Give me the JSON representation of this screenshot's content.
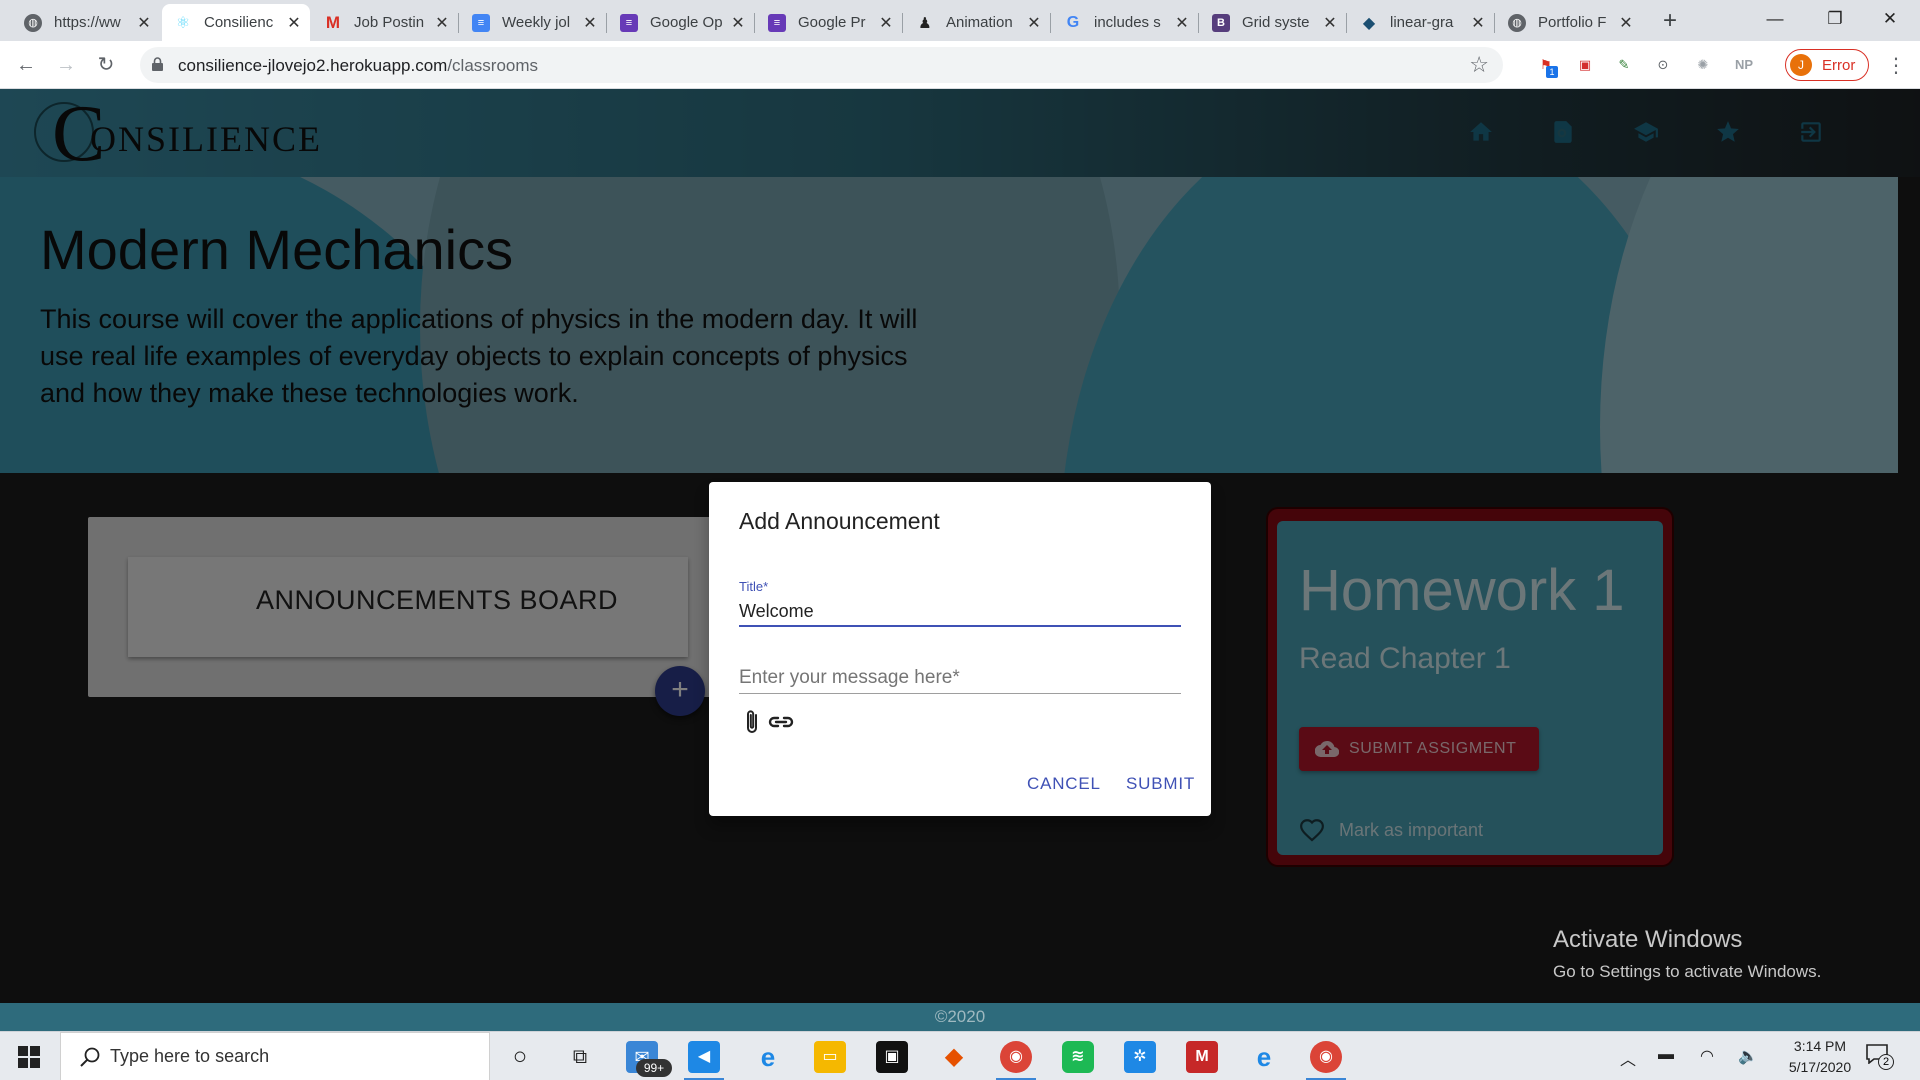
{
  "browser": {
    "tabs": [
      {
        "title": "https://ww",
        "icon": "globe-icon",
        "color": "#5f6368"
      },
      {
        "title": "Consilienc",
        "icon": "react-icon",
        "color": "#61dafb"
      },
      {
        "title": "Job Postin",
        "icon": "gmail-icon",
        "color": "#d93025"
      },
      {
        "title": "Weekly jol",
        "icon": "docs-icon",
        "color": "#4285f4"
      },
      {
        "title": "Google Op",
        "icon": "forms-icon",
        "color": "#673ab7"
      },
      {
        "title": "Google Pr",
        "icon": "forms-icon",
        "color": "#673ab7"
      },
      {
        "title": "Animation",
        "icon": "penguin-icon",
        "color": "#222222"
      },
      {
        "title": "includes s",
        "icon": "google-icon",
        "color": "#4285f4"
      },
      {
        "title": "Grid syste",
        "icon": "bootstrap-icon",
        "color": "#563d7c"
      },
      {
        "title": "linear-gra",
        "icon": "bird-icon",
        "color": "#1b4f72"
      },
      {
        "title": "Portfolio F",
        "icon": "globe-icon",
        "color": "#5f6368"
      }
    ],
    "active_tab_index": 1,
    "url_host": "consilience-jlovejo2.herokuapp.com",
    "url_path": "/classrooms",
    "profile": {
      "initial": "J",
      "label": "Error"
    },
    "ext_np": "NP",
    "ext_badge": "1"
  },
  "app": {
    "logo_letter": "C",
    "logo_text": "ONSILIENCE",
    "nav_icons": [
      "home-icon",
      "search-doc-icon",
      "school-icon",
      "star-icon",
      "exit-icon"
    ],
    "course": {
      "title": "Modern Mechanics",
      "description": "This course will cover the applications of physics in the modern day. It will use real life examples of everyday objects to explain concepts of physics and how they make these technologies work."
    },
    "announcements": {
      "title": "ANNOUNCEMENTS BOARD",
      "add_label": "+"
    },
    "homework": {
      "title": "Homework 1",
      "subtitle": "Read Chapter 1",
      "submit_label": "SUBMIT ASSIGMENT",
      "important_label": "Mark as important"
    },
    "footer": "©2020"
  },
  "dialog": {
    "title": "Add Announcement",
    "title_label": "Title*",
    "title_value": "Welcome",
    "message_placeholder": "Enter your message here*",
    "cancel_label": "CANCEL",
    "submit_label": "SUBMIT",
    "accent": "#3f51b5"
  },
  "watermark": {
    "line1": "Activate Windows",
    "line2": "Go to Settings to activate Windows."
  },
  "taskbar": {
    "search_placeholder": "Type here to search",
    "mail_badge": "99+",
    "time": "3:14 PM",
    "date": "5/17/2020",
    "notification_count": "2"
  }
}
